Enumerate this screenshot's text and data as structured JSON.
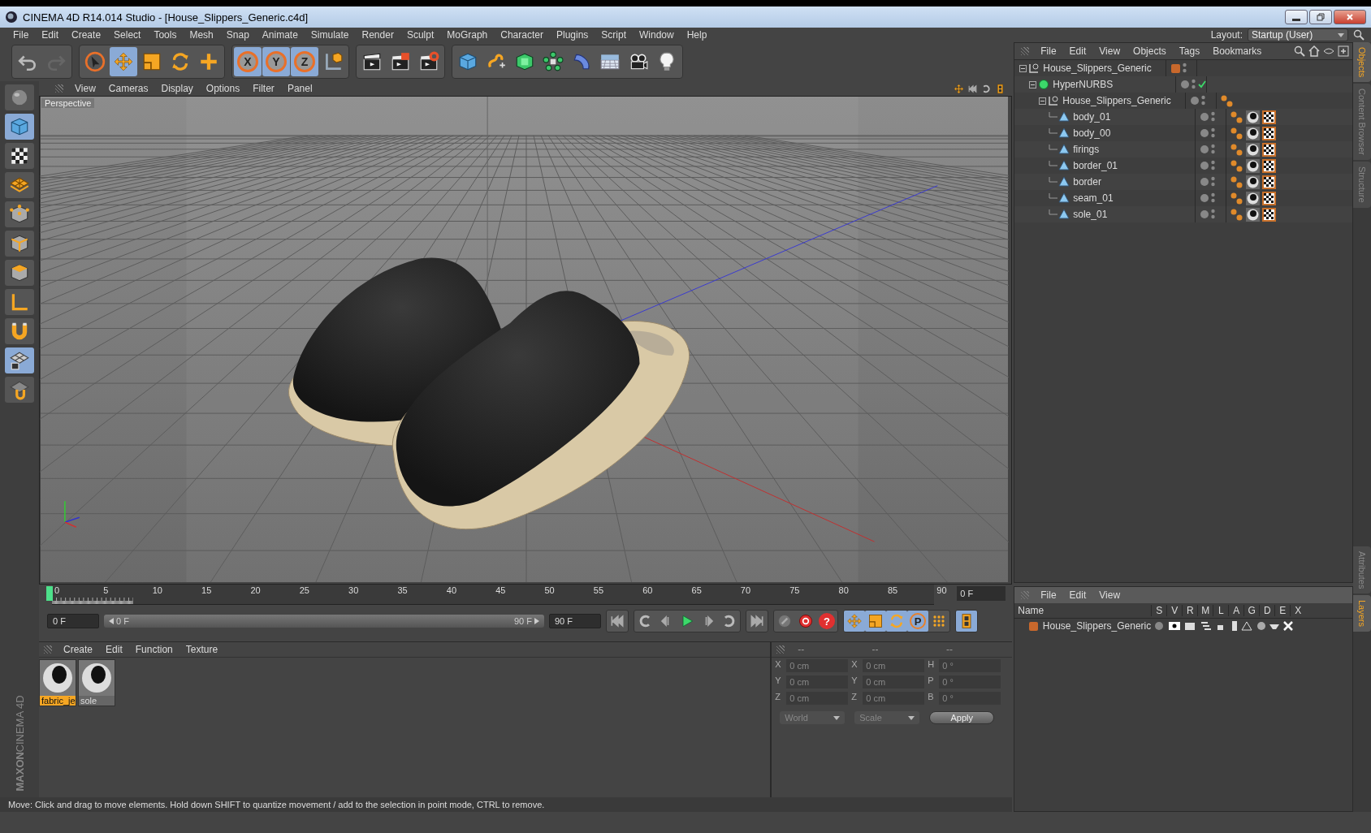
{
  "window": {
    "title": "CINEMA 4D R14.014 Studio - [House_Slippers_Generic.c4d]"
  },
  "menu": [
    "File",
    "Edit",
    "Create",
    "Select",
    "Tools",
    "Mesh",
    "Snap",
    "Animate",
    "Simulate",
    "Render",
    "Sculpt",
    "MoGraph",
    "Character",
    "Plugins",
    "Script",
    "Window",
    "Help"
  ],
  "layout": {
    "label": "Layout:",
    "value": "Startup (User)"
  },
  "toolbar": [
    [
      {
        "kind": "undo",
        "selected": false
      },
      {
        "kind": "redo",
        "selected": false
      }
    ],
    [
      {
        "kind": "select",
        "selected": false
      },
      {
        "kind": "move",
        "selected": true
      },
      {
        "kind": "scale",
        "selected": false
      },
      {
        "kind": "rotate",
        "selected": false
      },
      {
        "kind": "add",
        "selected": false
      }
    ],
    [
      {
        "kind": "axis",
        "label": "X",
        "selected": true
      },
      {
        "kind": "axis",
        "label": "Y",
        "selected": true
      },
      {
        "kind": "axis",
        "label": "Z",
        "selected": true
      },
      {
        "kind": "coord",
        "selected": false
      }
    ],
    [
      {
        "kind": "render",
        "selected": false
      },
      {
        "kind": "render-pv",
        "selected": false
      },
      {
        "kind": "render-settings",
        "selected": false
      }
    ],
    [
      {
        "kind": "cube",
        "selected": false
      },
      {
        "kind": "spline",
        "selected": false
      },
      {
        "kind": "nurbs",
        "selected": false
      },
      {
        "kind": "cloner",
        "selected": false
      },
      {
        "kind": "deformer",
        "selected": false
      },
      {
        "kind": "floor",
        "selected": false
      },
      {
        "kind": "camera",
        "selected": false
      },
      {
        "kind": "light",
        "selected": false
      }
    ]
  ],
  "left_tools": [
    {
      "kind": "sphere",
      "selected": false
    },
    {
      "kind": "cube",
      "selected": true
    },
    {
      "kind": "checker",
      "selected": false
    },
    {
      "kind": "texture",
      "selected": false
    },
    {
      "kind": "points",
      "selected": false
    },
    {
      "kind": "edges",
      "selected": false
    },
    {
      "kind": "polygons",
      "selected": false
    },
    {
      "kind": "axis",
      "selected": false
    },
    {
      "kind": "magnet",
      "selected": false
    },
    {
      "kind": "gridlock",
      "selected": true
    },
    {
      "kind": "snap",
      "selected": false
    }
  ],
  "logo": {
    "brand": "MAXON",
    "product": "CINEMA 4D"
  },
  "viewport": {
    "menu": [
      "View",
      "Cameras",
      "Display",
      "Options",
      "Filter",
      "Panel"
    ],
    "label": "Perspective"
  },
  "timeline": {
    "ruler_labels": [
      "0",
      "5",
      "10",
      "15",
      "20",
      "25",
      "30",
      "35",
      "40",
      "45",
      "50",
      "55",
      "60",
      "65",
      "70",
      "75",
      "80",
      "85",
      "90"
    ],
    "current_frame": "0 F",
    "start": "0 F",
    "range_start": "0 F",
    "range_end": "90 F",
    "end": "90 F"
  },
  "playback": [
    [
      {
        "kind": "first",
        "selected": false
      }
    ],
    [
      {
        "kind": "loop-back",
        "selected": false
      },
      {
        "kind": "step-back",
        "selected": false
      },
      {
        "kind": "play",
        "selected": false
      },
      {
        "kind": "step-forward",
        "selected": false
      },
      {
        "kind": "loop",
        "selected": false
      }
    ],
    [
      {
        "kind": "last",
        "selected": false
      }
    ],
    [
      {
        "kind": "key",
        "selected": false
      },
      {
        "kind": "record",
        "selected": false
      },
      {
        "kind": "help",
        "label": "?",
        "selected": false
      }
    ],
    [
      {
        "kind": "move",
        "selected": true
      },
      {
        "kind": "scale",
        "selected": true
      },
      {
        "kind": "rotate",
        "selected": true
      },
      {
        "kind": "param",
        "label": "P",
        "selected": true
      },
      {
        "kind": "dots",
        "selected": false
      }
    ],
    [
      {
        "kind": "film",
        "selected": true
      }
    ]
  ],
  "materials": {
    "menu": [
      "Create",
      "Edit",
      "Function",
      "Texture"
    ],
    "items": [
      {
        "name": "fabric_je",
        "selected": true
      },
      {
        "name": "sole",
        "selected": false
      }
    ]
  },
  "coordinates": {
    "headers": [
      "--",
      "--",
      "--"
    ],
    "rows": [
      [
        {
          "axis": "X",
          "value": "0 cm"
        },
        {
          "axis": "X",
          "value": "0 cm"
        },
        {
          "axis": "H",
          "value": "0 °"
        }
      ],
      [
        {
          "axis": "Y",
          "value": "0 cm"
        },
        {
          "axis": "Y",
          "value": "0 cm"
        },
        {
          "axis": "P",
          "value": "0 °"
        }
      ],
      [
        {
          "axis": "Z",
          "value": "0 cm"
        },
        {
          "axis": "Z",
          "value": "0 cm"
        },
        {
          "axis": "B",
          "value": "0 °"
        }
      ]
    ],
    "mode": "World",
    "type": "Scale",
    "apply": "Apply"
  },
  "objects": {
    "menu": [
      "File",
      "Edit",
      "View",
      "Objects",
      "Tags",
      "Bookmarks"
    ],
    "tree": [
      {
        "name": "House_Slippers_Generic",
        "kind": "null",
        "color": "#c8682c",
        "expanded": true,
        "phong_tag": false,
        "material_tag": false,
        "texture_tag": false,
        "children": [
          {
            "name": "HyperNURBS",
            "kind": "nurbs",
            "expanded": true,
            "enabled": true,
            "phong_tag": false,
            "material_tag": false,
            "texture_tag": false,
            "children": [
              {
                "name": "House_Slippers_Generic",
                "kind": "null",
                "expanded": true,
                "phong_tag": true,
                "material_tag": false,
                "texture_tag": false,
                "children": [
                  {
                    "name": "body_01",
                    "kind": "polygon",
                    "phong_tag": true,
                    "material_tag": true,
                    "texture_tag": true
                  },
                  {
                    "name": "body_00",
                    "kind": "polygon",
                    "phong_tag": true,
                    "material_tag": true,
                    "texture_tag": true
                  },
                  {
                    "name": "firings",
                    "kind": "polygon",
                    "phong_tag": true,
                    "material_tag": true,
                    "texture_tag": true
                  },
                  {
                    "name": "border_01",
                    "kind": "polygon",
                    "phong_tag": true,
                    "material_tag": true,
                    "texture_tag": true
                  },
                  {
                    "name": "border",
                    "kind": "polygon",
                    "phong_tag": true,
                    "material_tag": true,
                    "texture_tag": true
                  },
                  {
                    "name": "seam_01",
                    "kind": "polygon",
                    "phong_tag": true,
                    "material_tag": true,
                    "texture_tag": true
                  },
                  {
                    "name": "sole_01",
                    "kind": "polygon",
                    "phong_tag": true,
                    "material_tag": true,
                    "texture_tag": true
                  }
                ]
              }
            ]
          }
        ]
      }
    ]
  },
  "side_tabs_top": [
    {
      "label": "Objects",
      "selected": true
    },
    {
      "label": "Content Browser",
      "selected": false
    },
    {
      "label": "Structure",
      "selected": false
    }
  ],
  "layers": {
    "menu": [
      "File",
      "Edit",
      "View"
    ],
    "columns": [
      "Name",
      "S",
      "V",
      "R",
      "M",
      "L",
      "A",
      "G",
      "D",
      "E",
      "X"
    ],
    "rows": [
      {
        "name": "House_Slippers_Generic",
        "color": "#c8682c"
      }
    ]
  },
  "side_tabs_bottom": [
    {
      "label": "Attributes",
      "selected": false
    },
    {
      "label": "Layers",
      "selected": true
    }
  ],
  "status": "Move: Click and drag to move elements. Hold down SHIFT to quantize movement / add to the selection in point mode, CTRL to remove."
}
